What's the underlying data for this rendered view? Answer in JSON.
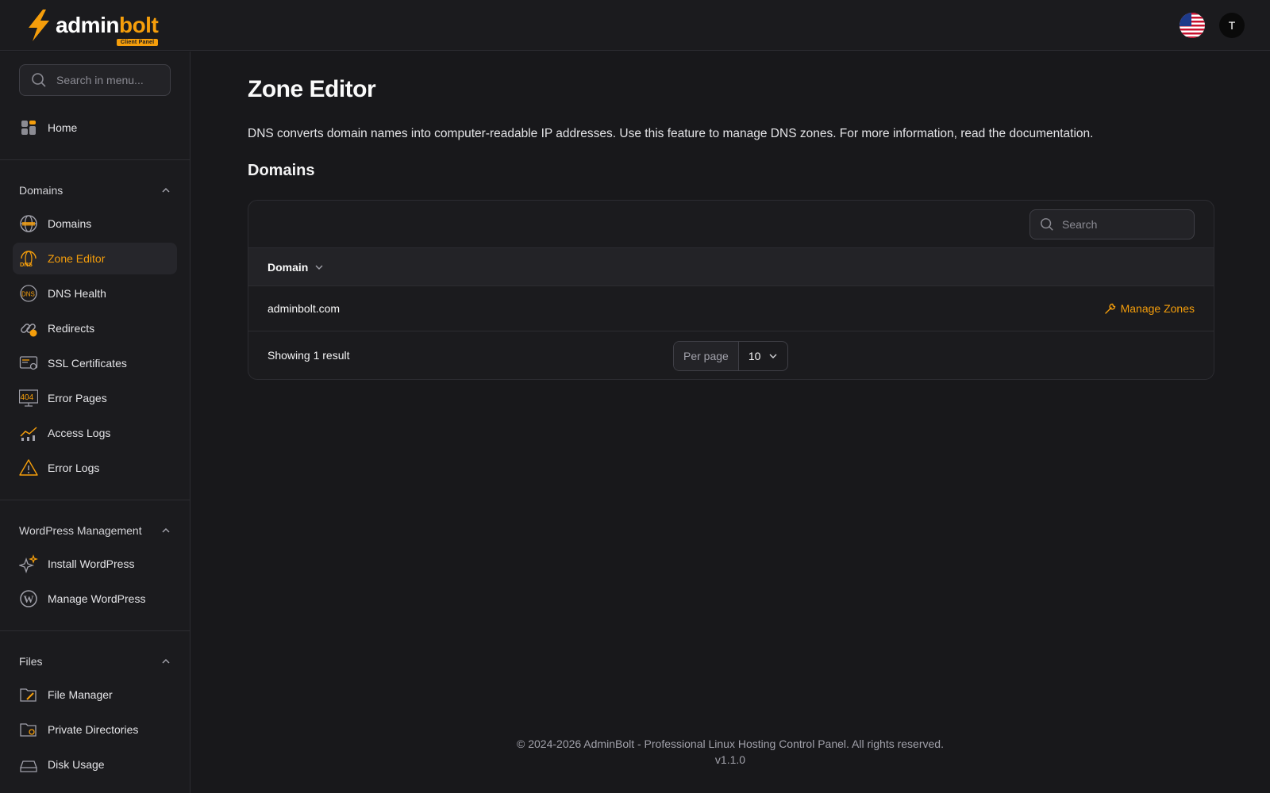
{
  "brand": {
    "name_white": "admin",
    "name_orange": "bolt",
    "badge": "Client Panel",
    "accent": "#f59e0b"
  },
  "topbar": {
    "language_icon": "us-flag-icon",
    "avatar_initial": "T"
  },
  "sidebar": {
    "search_placeholder": "Search in menu...",
    "home_label": "Home",
    "groups": [
      {
        "label": "Domains",
        "items": [
          {
            "label": "Domains",
            "icon": "globe-icon"
          },
          {
            "label": "Zone Editor",
            "icon": "dns-globe-icon",
            "active": true
          },
          {
            "label": "DNS Health",
            "icon": "dns-icon"
          },
          {
            "label": "Redirects",
            "icon": "link-icon"
          },
          {
            "label": "SSL Certificates",
            "icon": "certificate-icon"
          },
          {
            "label": "Error Pages",
            "icon": "404-icon"
          },
          {
            "label": "Access Logs",
            "icon": "chart-icon"
          },
          {
            "label": "Error Logs",
            "icon": "warning-icon"
          }
        ]
      },
      {
        "label": "WordPress Management",
        "items": [
          {
            "label": "Install WordPress",
            "icon": "sparkle-icon"
          },
          {
            "label": "Manage WordPress",
            "icon": "wordpress-icon"
          }
        ]
      },
      {
        "label": "Files",
        "items": [
          {
            "label": "File Manager",
            "icon": "folder-edit-icon"
          },
          {
            "label": "Private Directories",
            "icon": "folder-lock-icon"
          },
          {
            "label": "Disk Usage",
            "icon": "disk-icon"
          }
        ]
      }
    ]
  },
  "main": {
    "title": "Zone Editor",
    "description": "DNS converts domain names into computer-readable IP addresses. Use this feature to manage DNS zones. For more information, read the documentation.",
    "section_title": "Domains",
    "table": {
      "search_placeholder": "Search",
      "column_domain": "Domain",
      "rows": [
        {
          "domain": "adminbolt.com",
          "action": "Manage Zones"
        }
      ],
      "showing": "Showing 1 result",
      "per_page_label": "Per page",
      "per_page_value": "10"
    }
  },
  "footer": {
    "copyright": "© 2024-2026 AdminBolt - Professional Linux Hosting Control Panel. All rights reserved.",
    "version": "v1.1.0"
  }
}
